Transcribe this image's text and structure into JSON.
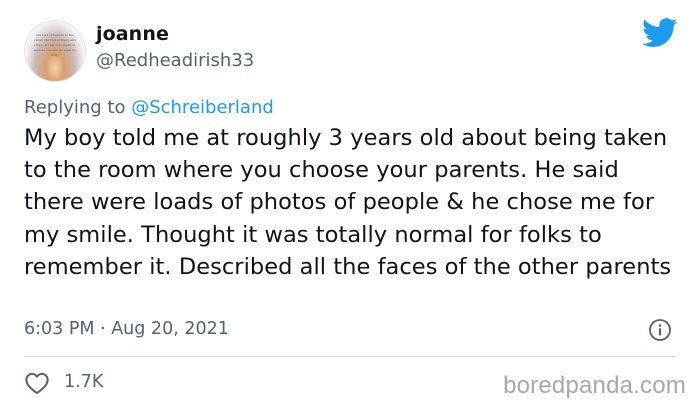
{
  "author": {
    "name": "joanne",
    "handle": "@Redheadirish33",
    "avatar_quote": "the lord of heaven to the valley. the rest of many and other . is that said mention, such as you can we shall we sing ."
  },
  "reply": {
    "prefix": "Replying to ",
    "mention": "@Schreiberland"
  },
  "tweet": {
    "text": "My boy told me at roughly 3 years old about being taken to the room where you choose your parents. He said there were loads of photos of people & he chose me for my smile. Thought it was totally normal for folks to remember it. Described all the faces of the other parents",
    "timestamp": "6:03 PM · Aug 20, 2021"
  },
  "stats": {
    "likes": "1.7K"
  },
  "watermark": "boredpanda.com",
  "colors": {
    "twitter_blue": "#1d9bf0",
    "muted": "#536471",
    "text": "#0f1419",
    "divider": "#cfd9de"
  },
  "icons": [
    "twitter-logo-icon",
    "info-icon",
    "heart-icon"
  ]
}
